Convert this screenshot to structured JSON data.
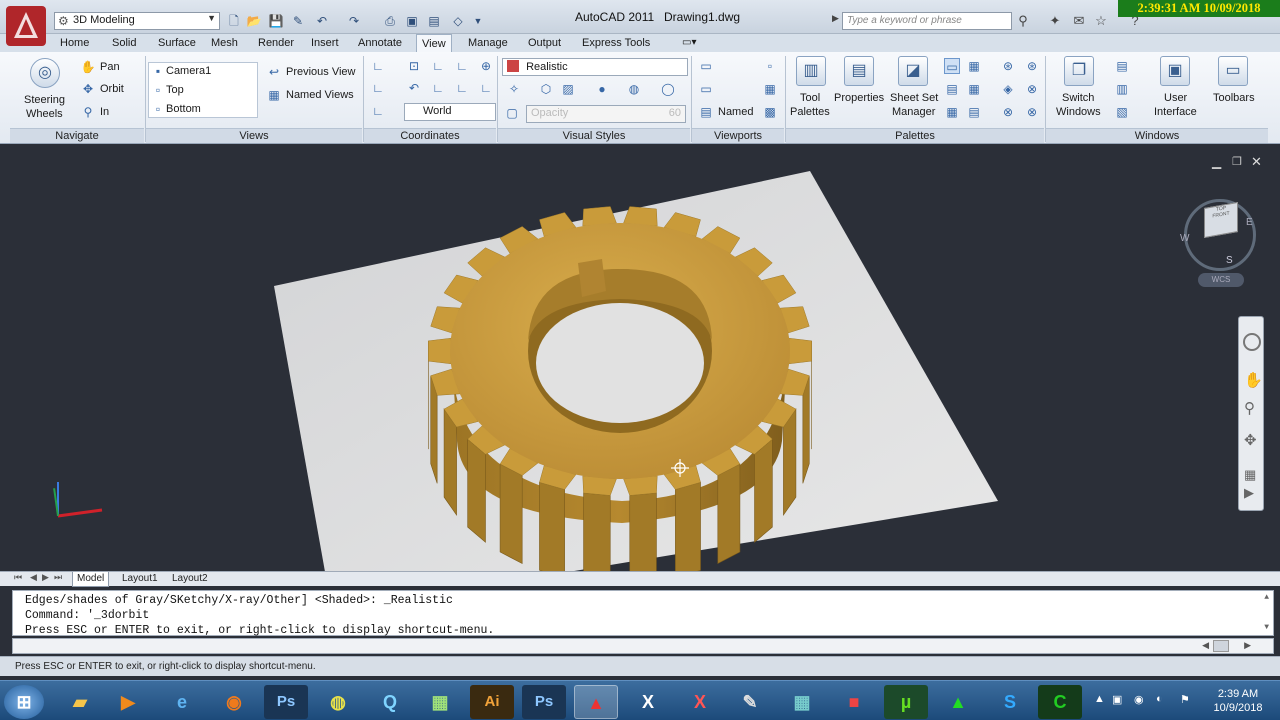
{
  "titlebar": {
    "workspace": "3D Modeling",
    "app_title": "AutoCAD 2011",
    "doc_title": "Drawing1.dwg",
    "search_placeholder": "Type a keyword or phrase",
    "clock_overlay": "2:39:31 AM 10/09/2018"
  },
  "tabs": [
    "Home",
    "Solid",
    "Surface",
    "Mesh",
    "Render",
    "Insert",
    "Annotate",
    "View",
    "Manage",
    "Output",
    "Express Tools"
  ],
  "active_tab": "View",
  "ribbon": {
    "navigate": {
      "label": "Navigate",
      "steering_wheels": "Steering Wheels",
      "steering_line1": "Steering",
      "steering_line2": "Wheels",
      "pan": "Pan",
      "orbit": "Orbit",
      "zoom": "In"
    },
    "views": {
      "label": "Views",
      "items": [
        "Camera1",
        "Top",
        "Bottom"
      ],
      "previous_view": "Previous View",
      "named_views": "Named Views"
    },
    "coordinates": {
      "label": "Coordinates",
      "ucs": "World"
    },
    "visual_styles": {
      "label": "Visual Styles",
      "current": "Realistic",
      "opacity_label": "Opacity",
      "opacity_value": "60"
    },
    "viewports": {
      "label": "Viewports",
      "named": "Named"
    },
    "palettes": {
      "label": "Palettes",
      "tool_palettes_1": "Tool",
      "tool_palettes_2": "Palettes",
      "properties": "Properties",
      "sheet_set_1": "Sheet Set",
      "sheet_set_2": "Manager"
    },
    "windows": {
      "label": "Windows",
      "switch_1": "Switch",
      "switch_2": "Windows",
      "user_interface_1": "User",
      "user_interface_2": "Interface",
      "toolbars": "Toolbars"
    }
  },
  "viewcube": {
    "top": "TOP",
    "front": "FRONT",
    "west": "W",
    "east": "E",
    "south": "S",
    "wcs": "WCS"
  },
  "layout_tabs": [
    "Model",
    "Layout1",
    "Layout2"
  ],
  "command_history": [
    "Edges/shades of Gray/SKetchy/X-ray/Other] <Shaded>: _Realistic",
    "Command: '_3dorbit",
    "Press ESC or ENTER to exit, or right-click to display shortcut-menu."
  ],
  "status_text": "Press ESC or ENTER to exit, or right-click to display shortcut-menu.",
  "taskbar": {
    "time": "2:39 AM",
    "date": "10/9/2018",
    "apps": [
      "start",
      "explorer",
      "media",
      "internet-explorer",
      "firefox",
      "photoshop",
      "chrome",
      "qq",
      "capture",
      "illustrator",
      "photoshop-2",
      "autocad",
      "excel",
      "xmind",
      "app-13",
      "app-14",
      "app-15",
      "utorrent",
      "app-17",
      "skype",
      "camtasia"
    ]
  },
  "colors": {
    "gear": "#c4972f",
    "viewport_bg": "#2b2f38",
    "plane": "#dcdcdc",
    "overlay_bg": "#1b7d1b",
    "overlay_text": "#ffe800"
  }
}
